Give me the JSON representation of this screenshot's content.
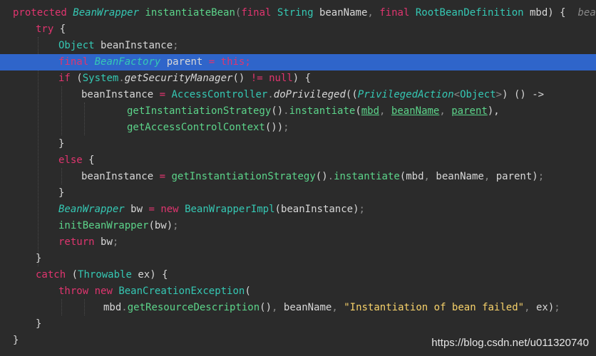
{
  "editor": {
    "watermark": "https://blog.csdn.net/u011320740",
    "colors": {
      "background": "#2b2b2b",
      "current_line_highlight": "#2f65ca",
      "keyword": "#e0356f",
      "type": "#35c8b4",
      "method": "#5cd48a",
      "string": "#f7d26a",
      "plain": "#d7d7d7"
    }
  },
  "code": {
    "l0": {
      "kw1": "protected",
      "t1": "BeanWrapper",
      "fn1": "instantiateBean",
      "p1": "(",
      "kw2": "final",
      "t2": "String",
      "v1": "beanName",
      "c1": ",",
      "kw3": "final",
      "t3": "RootBeanDefinition",
      "v2": "mbd",
      "p2": ")",
      "b1": "{",
      "hint": "beanName"
    },
    "l1": {
      "kw1": "try",
      "b1": "{"
    },
    "l2": {
      "t1": "Object",
      "v1": "beanInstance",
      "s1": ";"
    },
    "l3": {
      "kw1": "final",
      "t1": "BeanFactory",
      "v1": "parent",
      "op": "=",
      "kw2": "this",
      "s1": ";"
    },
    "l4": {
      "kw1": "if",
      "p1": "(",
      "t1": "System",
      "dot": ".",
      "fn1": "getSecurityManager",
      "p2": "()",
      "op": "!=",
      "kw2": "null",
      "p3": ")",
      "b1": "{"
    },
    "l5": {
      "v1": "beanInstance",
      "op": "=",
      "t1": "AccessController",
      "dot": ".",
      "fn1": "doPrivileged",
      "p1": "((",
      "t2": "PrivilegedAction",
      "lt": "<",
      "t3": "Object",
      "gt": ">",
      "p2": ")",
      "lam": "() ->"
    },
    "l6": {
      "fn1": "getInstantiationStrategy",
      "p1": "()",
      "dot": ".",
      "fn2": "instantiate",
      "p2": "(",
      "a1": "mbd",
      "c1": ",",
      "a2": "beanName",
      "c2": ",",
      "a3": "parent",
      "p3": "),"
    },
    "l7": {
      "fn1": "getAccessControlContext",
      "p1": "())",
      "s1": ";"
    },
    "l8": {
      "b1": "}"
    },
    "l9": {
      "kw1": "else",
      "b1": "{"
    },
    "l10": {
      "v1": "beanInstance",
      "op": "=",
      "fn1": "getInstantiationStrategy",
      "p1": "()",
      "dot": ".",
      "fn2": "instantiate",
      "p2": "(",
      "a1": "mbd",
      "c1": ",",
      "a2": "beanName",
      "c2": ",",
      "a3": "parent",
      "p3": ")",
      "s1": ";"
    },
    "l11": {
      "b1": "}"
    },
    "l12": {
      "t1": "BeanWrapper",
      "v1": "bw",
      "op": "=",
      "kw1": "new",
      "t2": "BeanWrapperImpl",
      "p1": "(",
      "a1": "beanInstance",
      "p2": ")",
      "s1": ";"
    },
    "l13": {
      "fn1": "initBeanWrapper",
      "p1": "(",
      "a1": "bw",
      "p2": ")",
      "s1": ";"
    },
    "l14": {
      "kw1": "return",
      "v1": "bw",
      "s1": ";"
    },
    "l15": {
      "b1": "}"
    },
    "l16": {
      "kw1": "catch",
      "p1": "(",
      "t1": "Throwable",
      "v1": "ex",
      "p2": ")",
      "b1": "{"
    },
    "l17": {
      "kw1": "throw",
      "kw2": "new",
      "t1": "BeanCreationException",
      "p1": "("
    },
    "l18": {
      "v1": "mbd",
      "dot": ".",
      "fn1": "getResourceDescription",
      "p1": "()",
      "c1": ",",
      "a1": "beanName",
      "c2": ",",
      "str": "\"Instantiation of bean failed\"",
      "c3": ",",
      "a2": "ex",
      "p2": ")",
      "s1": ";"
    },
    "l19": {
      "b1": "}"
    },
    "l20": {
      "b1": "}"
    }
  }
}
